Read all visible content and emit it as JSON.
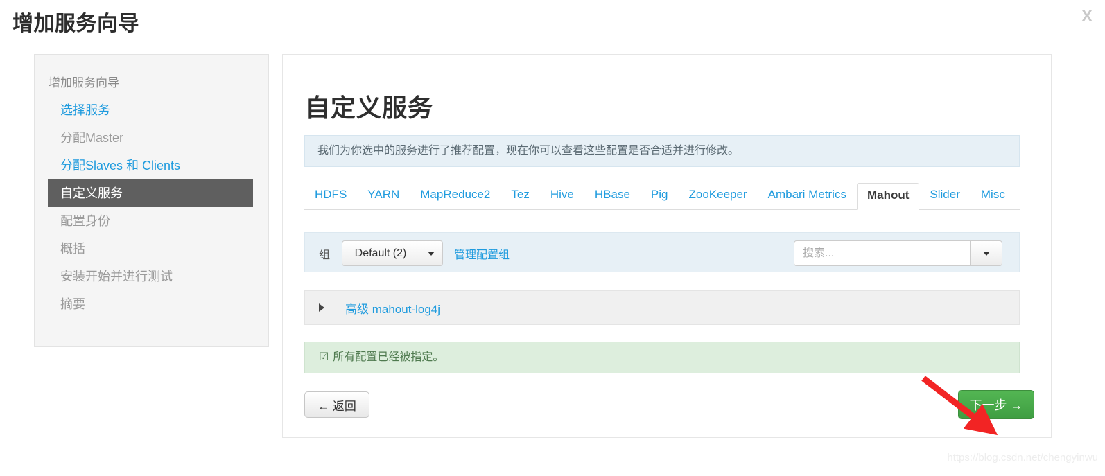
{
  "header": {
    "title": "增加服务向导",
    "close_label": "X"
  },
  "sidebar": {
    "heading": "增加服务向导",
    "items": [
      {
        "label": "选择服务",
        "state": "link"
      },
      {
        "label": "分配Master",
        "state": "muted"
      },
      {
        "label": "分配Slaves 和 Clients",
        "state": "link"
      },
      {
        "label": "自定义服务",
        "state": "active"
      },
      {
        "label": "配置身份",
        "state": "muted"
      },
      {
        "label": "概括",
        "state": "muted"
      },
      {
        "label": "安装开始并进行测试",
        "state": "muted"
      },
      {
        "label": "摘要",
        "state": "muted"
      }
    ]
  },
  "main": {
    "page_title": "自定义服务",
    "info_text": "我们为你选中的服务进行了推荐配置，现在你可以查看这些配置是否合适并进行修改。",
    "tabs": [
      {
        "label": "HDFS",
        "active": false
      },
      {
        "label": "YARN",
        "active": false
      },
      {
        "label": "MapReduce2",
        "active": false
      },
      {
        "label": "Tez",
        "active": false
      },
      {
        "label": "Hive",
        "active": false
      },
      {
        "label": "HBase",
        "active": false
      },
      {
        "label": "Pig",
        "active": false
      },
      {
        "label": "ZooKeeper",
        "active": false
      },
      {
        "label": "Ambari Metrics",
        "active": false
      },
      {
        "label": "Mahout",
        "active": true
      },
      {
        "label": "Slider",
        "active": false
      },
      {
        "label": "Misc",
        "active": false
      }
    ],
    "filter_bar": {
      "group_label": "组",
      "group_value": "Default (2)",
      "manage_link": "管理配置组",
      "search_placeholder": "搜索...",
      "search_value": ""
    },
    "accordion": {
      "label": "高级 mahout-log4j"
    },
    "success": {
      "icon": "check-square-icon",
      "text": "所有配置已经被指定。"
    },
    "buttons": {
      "back": "← 返回",
      "next": "下一步 →"
    }
  },
  "annotation": {
    "arrow_color": "#f22424",
    "target": "next-button"
  },
  "watermark": {
    "text": "https://blog.csdn.net/chengyinwu"
  },
  "colors": {
    "link": "#1f9bde",
    "active_sidebar_bg": "#5f5f5f",
    "info_bg": "#e7f0f6",
    "success_bg": "#ddeedd",
    "next_button": "#49a849"
  }
}
